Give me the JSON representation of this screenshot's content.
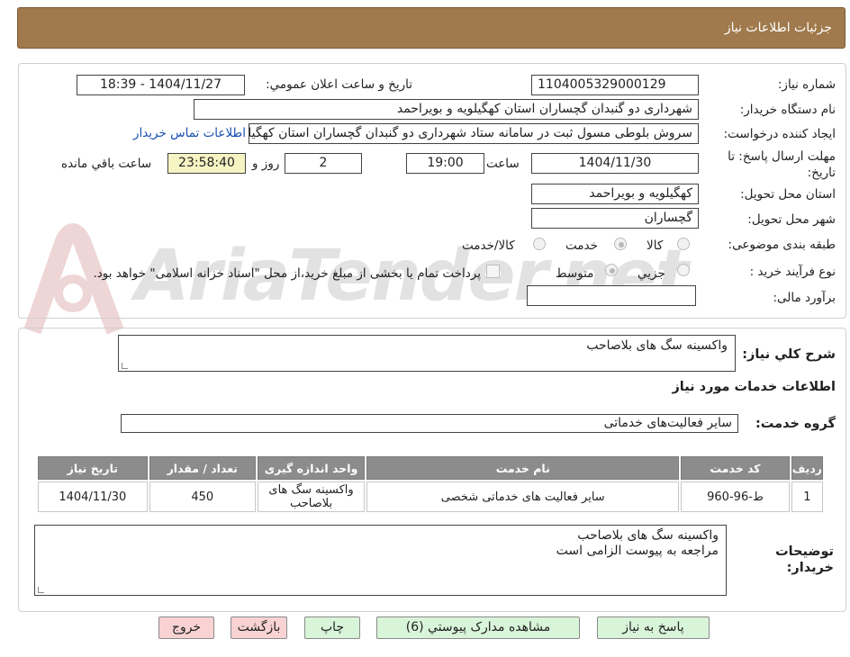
{
  "header": {
    "title": "جزئيات اطلاعات نياز"
  },
  "watermark": {
    "text": "AriaTender.net"
  },
  "form": {
    "need_number_label": "شماره نياز:",
    "need_number": "1104005329000129",
    "announce_label": "تاريخ و ساعت اعلان عمومي:",
    "announce_value": "1404/11/27 - 18:39",
    "buyer_org_label": "نام دستگاه خريدار:",
    "buyer_org": "شهرداری دو گنبدان گچساران استان کهگیلویه و بویراحمد",
    "requester_label": "ايجاد کننده درخواست:",
    "requester": "سروش بلوطی مسول ثبت در سامانه ستاد شهرداری دو گنبدان گچساران استان کهگیلویه و بویراحمد",
    "contact_link": "اطلاعات تماس خريدار",
    "deadline_label_1": "مهلت ارسال پاسخ: تا",
    "deadline_label_2": "تاريخ:",
    "deadline_date": "1404/11/30",
    "time_label": "ساعت",
    "deadline_time": "19:00",
    "days_value": "2",
    "days_label": "روز و",
    "remaining_time": "23:58:40",
    "remaining_label": "ساعت باقي مانده",
    "province_label": "استان محل تحويل:",
    "province": "کهگیلویه و بویراحمد",
    "city_label": "شهر محل تحويل:",
    "city": "گچساران",
    "category_label": "طبقه بندی موضوعی:",
    "category_options": [
      "کالا",
      "خدمت",
      "کالا/خدمت"
    ],
    "purchase_label": "نوع فرآيند خريد :",
    "purchase_options": [
      "جزيي",
      "متوسط"
    ],
    "payment_note": "پرداخت تمام يا بخشی از مبلغ خريد،از محل \"اسناد خزانه اسلامی\" خواهد بود.",
    "budget_label": "برآورد مالی:",
    "budget_value": ""
  },
  "summary": {
    "label": "شرح کلي نياز:",
    "value": "واکسینه سگ های بلاصاحب"
  },
  "services": {
    "section_title": "اطلاعات خدمات مورد نياز",
    "group_label": "گروه خدمت:",
    "group_value": "ساير فعاليت‌های خدماتی",
    "columns": [
      "رديف",
      "کد خدمت",
      "نام خدمت",
      "واحد اندازه گيری",
      "تعداد / مقدار",
      "تاريخ نياز"
    ],
    "rows": [
      [
        "1",
        "ط-96-960",
        "ساير فعاليت های خدماتی شخصی",
        "واکسینه سگ های بلاصاحب",
        "450",
        "1404/11/30"
      ]
    ]
  },
  "buyer_notes": {
    "label_1": "توضيحات",
    "label_2": "خريدار:",
    "line_1": "واکسینه سگ های بلاصاحب",
    "line_2": "مراجعه به پیوست الزامی است"
  },
  "buttons": {
    "reply": "پاسخ به نياز",
    "attachments": "مشاهده مدارک پيوستي (6)",
    "print": "چاپ",
    "back": "بازگشت",
    "exit": "خروج"
  },
  "colors": {
    "header_bg": "#a07a4c",
    "table_header": "#8c8c8c",
    "remaining_bg": "#f7f4c4"
  }
}
